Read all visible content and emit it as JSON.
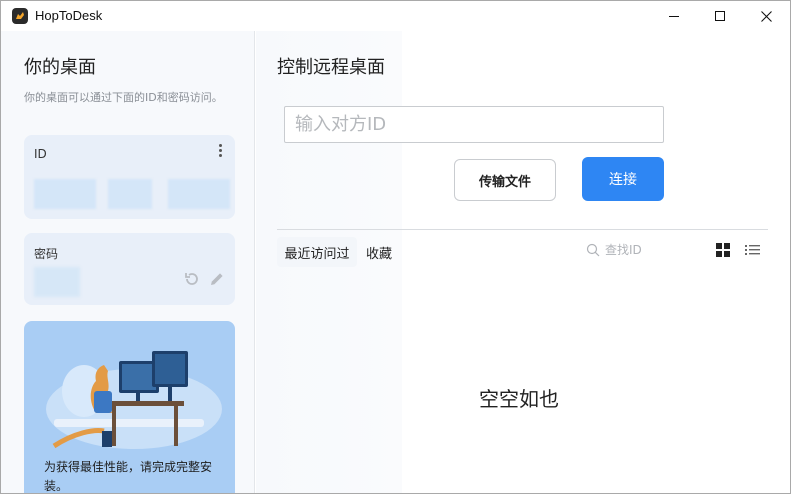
{
  "app": {
    "title": "HopToDesk"
  },
  "window_controls": {
    "minimize": "minimize-icon",
    "maximize": "maximize-icon",
    "close": "close-icon"
  },
  "left": {
    "title": "你的桌面",
    "description": "你的桌面可以通过下面的ID和密码访问。",
    "id_card": {
      "label": "ID"
    },
    "password_card": {
      "label": "密码"
    },
    "promo_text": "为获得最佳性能，请完成完整安装。"
  },
  "main": {
    "title": "控制远程桌面",
    "id_input_placeholder": "输入对方ID",
    "transfer_button": "传输文件",
    "connect_button": "连接",
    "tabs": [
      {
        "label": "最近访问过",
        "active": true
      },
      {
        "label": "收藏",
        "active": false
      }
    ],
    "search_placeholder": "查找ID",
    "empty_text": "空空如也"
  },
  "colors": {
    "accent": "#2e86f3",
    "promo_bg": "#a9cdf4",
    "card_bg": "#e8eff9"
  }
}
